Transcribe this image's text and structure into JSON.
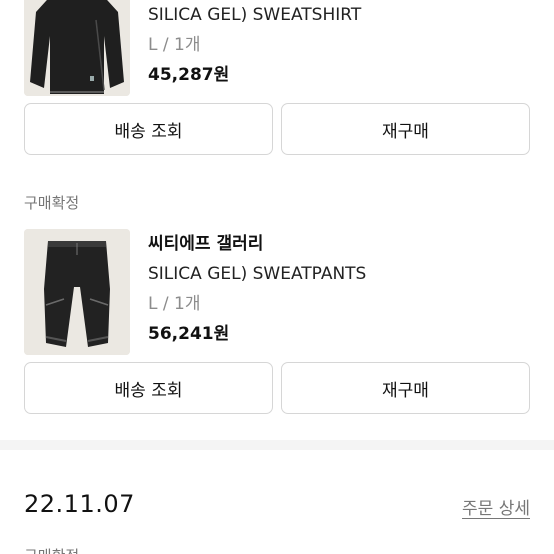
{
  "orders": [
    {
      "brand": "",
      "product": "SILICA GEL) SWEATSHIRT",
      "option": "L / 1개",
      "price": "45,287원",
      "buttons": {
        "track": "배송 조회",
        "rebuy": "재구매"
      }
    },
    {
      "status": "구매확정",
      "brand": "씨티에프 갤러리",
      "product": "SILICA GEL) SWEATPANTS",
      "option": "L / 1개",
      "price": "56,241원",
      "buttons": {
        "track": "배송 조회",
        "rebuy": "재구매"
      }
    }
  ],
  "order_group": {
    "date": "22.11.07",
    "detail_link": "주문 상세",
    "next_status": "구매확정"
  }
}
